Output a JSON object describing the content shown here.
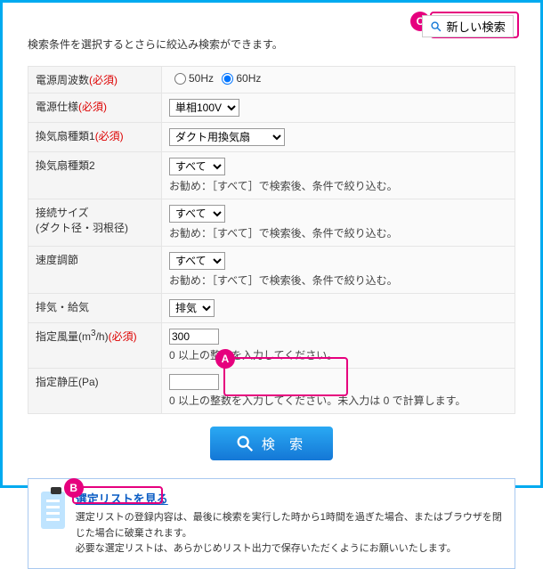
{
  "intro": "検索条件を選択するとさらに絞込み検索ができます。",
  "newSearch": {
    "label": "新しい検索"
  },
  "badges": {
    "a": "A",
    "b": "B",
    "c": "C"
  },
  "form": {
    "required": "(必須)",
    "rows": {
      "freq": {
        "label": "電源周波数",
        "req": true,
        "opt1": "50Hz",
        "opt2": "60Hz"
      },
      "spec": {
        "label": "電源仕様",
        "req": true,
        "value": "単相100V"
      },
      "type1": {
        "label": "換気扇種類1",
        "req": true,
        "value": "ダクト用換気扇"
      },
      "type2": {
        "label": "換気扇種類2",
        "req": false,
        "value": "すべて",
        "hint": "お勧め：［すべて］で検索後、条件で絞り込む。"
      },
      "conn": {
        "label": "接続サイズ",
        "label2": "(ダクト径・羽根径)",
        "req": false,
        "value": "すべて",
        "hint": "お勧め：［すべて］で検索後、条件で絞り込む。"
      },
      "speed": {
        "label": "速度調節",
        "req": false,
        "value": "すべて",
        "hint": "お勧め：［すべて］で検索後、条件で絞り込む。"
      },
      "vent": {
        "label": "排気・給気",
        "req": false,
        "value": "排気"
      },
      "air": {
        "label_pre": "指定風量(m",
        "label_sup": "3",
        "label_post": "/h)",
        "req": true,
        "value": "300",
        "hint": "0 以上の整数を入力してください。"
      },
      "press": {
        "label": "指定静圧(Pa)",
        "req": false,
        "value": "",
        "hint": "0 以上の整数を入力してください。未入力は 0 で計算します。"
      }
    }
  },
  "searchBtn": "検 索",
  "info": {
    "title": "選定リストを見る",
    "line1": "選定リストの登録内容は、最後に検索を実行した時から1時間を過ぎた場合、またはブラウザを閉じた場合に破棄されます。",
    "line2": "必要な選定リストは、あらかじめリスト出力で保存いただくようにお願いいたします。"
  }
}
